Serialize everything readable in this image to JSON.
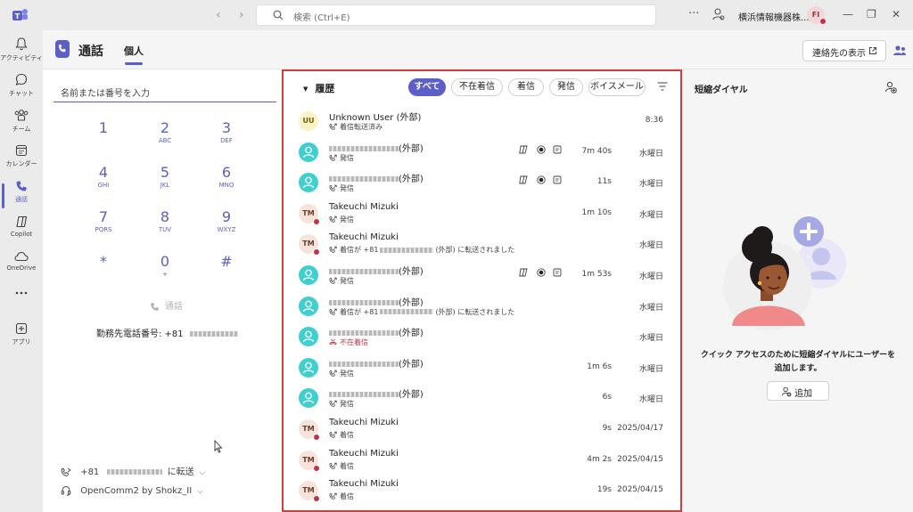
{
  "titlebar": {
    "search_placeholder": "検索 (Ctrl+E)",
    "more": "···",
    "org": "横浜情報機器株...",
    "avatar_initials": "FI",
    "min": "—",
    "restore": "❐",
    "close": "✕"
  },
  "rail": [
    {
      "label": "アクティビティ",
      "icon": "bell-icon"
    },
    {
      "label": "チャット",
      "icon": "chat-icon"
    },
    {
      "label": "チーム",
      "icon": "teams-icon"
    },
    {
      "label": "カレンダー",
      "icon": "calendar-icon"
    },
    {
      "label": "通話",
      "icon": "phone-icon",
      "active": true
    },
    {
      "label": "Copilot",
      "icon": "copilot-icon"
    },
    {
      "label": "OneDrive",
      "icon": "cloud-icon"
    },
    {
      "label": "",
      "icon": "more-icon"
    },
    {
      "label": "アプリ",
      "icon": "apps-icon"
    }
  ],
  "header": {
    "title": "通話",
    "tab": "個人",
    "show_contacts": "連絡先の表示"
  },
  "dial": {
    "placeholder": "名前または番号を入力",
    "keys": [
      {
        "d": "1",
        "s": ""
      },
      {
        "d": "2",
        "s": "ABC"
      },
      {
        "d": "3",
        "s": "DEF"
      },
      {
        "d": "4",
        "s": "GHI"
      },
      {
        "d": "5",
        "s": "JKL"
      },
      {
        "d": "6",
        "s": "MNO"
      },
      {
        "d": "7",
        "s": "PQRS"
      },
      {
        "d": "8",
        "s": "TUV"
      },
      {
        "d": "9",
        "s": "WXYZ"
      },
      {
        "d": "*",
        "s": ""
      },
      {
        "d": "0",
        "s": "+"
      },
      {
        "d": "#",
        "s": ""
      }
    ],
    "call_label": "通話",
    "work_number_label": "勤務先電話番号: +81",
    "forward_prefix": "+81",
    "forward_suffix": "に転送",
    "device": "OpenComm2 by Shokz_II"
  },
  "history": {
    "title": "履歴",
    "filters": [
      "すべて",
      "不在着信",
      "着信",
      "発信",
      "ボイスメール"
    ],
    "rows": [
      {
        "avatar": "UU",
        "type": "uu",
        "name": "Unknown User (外部)",
        "sub": "着信転送済み",
        "icons": false,
        "duration": "",
        "when": "8:36"
      },
      {
        "avatar": "",
        "type": "ext",
        "name_blur": true,
        "name_suffix": "(外部)",
        "sub": "発信",
        "icons": true,
        "duration": "7m 40s",
        "when": "水曜日"
      },
      {
        "avatar": "",
        "type": "ext",
        "name_blur": true,
        "name_suffix": "(外部)",
        "sub": "発信",
        "icons": true,
        "duration": "11s",
        "when": "水曜日"
      },
      {
        "avatar": "TM",
        "type": "tm",
        "name": "Takeuchi Mizuki",
        "sub": "発信",
        "icons": false,
        "duration": "1m 10s",
        "when": "水曜日"
      },
      {
        "avatar": "TM",
        "type": "tm",
        "name": "Takeuchi Mizuki",
        "sub_prefix": "着信が +81",
        "sub_suffix": "(外部) に転送されました",
        "icons": false,
        "duration": "",
        "when": "水曜日"
      },
      {
        "avatar": "",
        "type": "ext",
        "name_blur": true,
        "name_suffix": "(外部)",
        "sub": "発信",
        "icons": true,
        "duration": "1m 53s",
        "when": "水曜日"
      },
      {
        "avatar": "",
        "type": "ext",
        "name_blur": true,
        "name_suffix": "(外部)",
        "sub_prefix": "着信が +81",
        "sub_suffix": "(外部) に転送されました",
        "icons": false,
        "duration": "",
        "when": "水曜日"
      },
      {
        "avatar": "",
        "type": "ext",
        "name_blur": true,
        "name_suffix": "(外部)",
        "sub": "不在着信",
        "missed": true,
        "icons": false,
        "duration": "",
        "when": "水曜日"
      },
      {
        "avatar": "",
        "type": "ext",
        "name_blur": true,
        "name_suffix": "(外部)",
        "sub": "発信",
        "icons": false,
        "duration": "1m 6s",
        "when": "水曜日"
      },
      {
        "avatar": "",
        "type": "ext",
        "name_blur": true,
        "name_suffix": "(外部)",
        "sub": "発信",
        "icons": false,
        "duration": "6s",
        "when": "水曜日"
      },
      {
        "avatar": "TM",
        "type": "tm",
        "name": "Takeuchi Mizuki",
        "sub": "着信",
        "icons": false,
        "duration": "9s",
        "when": "2025/04/17"
      },
      {
        "avatar": "TM",
        "type": "tm",
        "name": "Takeuchi Mizuki",
        "sub": "着信",
        "icons": false,
        "duration": "4m 2s",
        "when": "2025/04/15"
      },
      {
        "avatar": "TM",
        "type": "tm",
        "name": "Takeuchi Mizuki",
        "sub": "着信",
        "icons": false,
        "duration": "19s",
        "when": "2025/04/15"
      }
    ]
  },
  "speed_dial": {
    "title": "短縮ダイヤル",
    "message": "クイック アクセスのために短縮ダイヤルにユーザーを追加します。",
    "add_label": "追加"
  },
  "colors": {
    "accent": "#5b5fc7",
    "highlight_border": "#d83b3b",
    "external_avatar": "#3fcfcf",
    "presence_busy": "#c4314b"
  }
}
